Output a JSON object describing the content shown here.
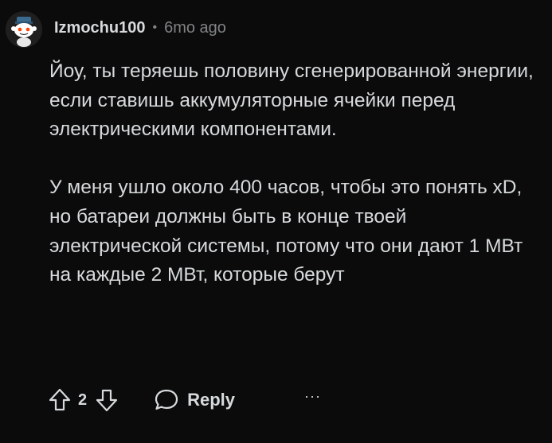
{
  "comment": {
    "author": "Izmochu100",
    "separator": "•",
    "timestamp": "6mo ago",
    "paragraphs": [
      "Йоу, ты теряешь половину сгенерированной энергии, если ставишь аккумуляторные ячейки перед электрическими компонентами.",
      "У меня ушло около 400 часов, чтобы это понять xD, но батареи должны быть в конце твоей электрической системы, потому что они дают 1 МВт на каждые 2 МВт, которые берут"
    ]
  },
  "actions": {
    "vote_count": "2",
    "reply_label": "Reply",
    "more_label": "···",
    "upvote_icon": "upvote-arrow-icon",
    "downvote_icon": "downvote-arrow-icon",
    "reply_icon": "speech-bubble-icon"
  },
  "colors": {
    "background": "#0b0b0b",
    "text": "#d7dadc",
    "muted": "#818384"
  }
}
